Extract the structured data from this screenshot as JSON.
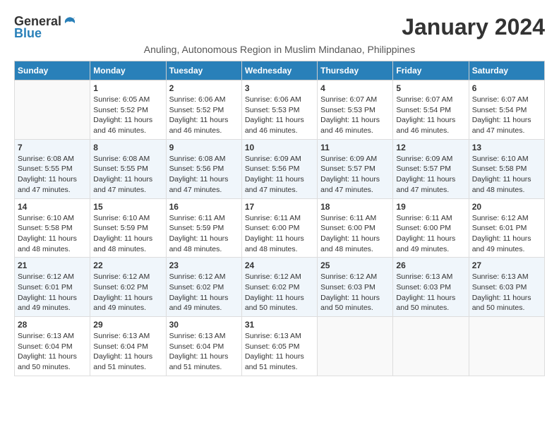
{
  "header": {
    "logo_general": "General",
    "logo_blue": "Blue",
    "month_title": "January 2024",
    "subtitle": "Anuling, Autonomous Region in Muslim Mindanao, Philippines"
  },
  "weekdays": [
    "Sunday",
    "Monday",
    "Tuesday",
    "Wednesday",
    "Thursday",
    "Friday",
    "Saturday"
  ],
  "weeks": [
    [
      {
        "day": null,
        "sunrise": null,
        "sunset": null,
        "daylight": null
      },
      {
        "day": "1",
        "sunrise": "Sunrise: 6:05 AM",
        "sunset": "Sunset: 5:52 PM",
        "daylight": "Daylight: 11 hours and 46 minutes."
      },
      {
        "day": "2",
        "sunrise": "Sunrise: 6:06 AM",
        "sunset": "Sunset: 5:52 PM",
        "daylight": "Daylight: 11 hours and 46 minutes."
      },
      {
        "day": "3",
        "sunrise": "Sunrise: 6:06 AM",
        "sunset": "Sunset: 5:53 PM",
        "daylight": "Daylight: 11 hours and 46 minutes."
      },
      {
        "day": "4",
        "sunrise": "Sunrise: 6:07 AM",
        "sunset": "Sunset: 5:53 PM",
        "daylight": "Daylight: 11 hours and 46 minutes."
      },
      {
        "day": "5",
        "sunrise": "Sunrise: 6:07 AM",
        "sunset": "Sunset: 5:54 PM",
        "daylight": "Daylight: 11 hours and 46 minutes."
      },
      {
        "day": "6",
        "sunrise": "Sunrise: 6:07 AM",
        "sunset": "Sunset: 5:54 PM",
        "daylight": "Daylight: 11 hours and 47 minutes."
      }
    ],
    [
      {
        "day": "7",
        "sunrise": "Sunrise: 6:08 AM",
        "sunset": "Sunset: 5:55 PM",
        "daylight": "Daylight: 11 hours and 47 minutes."
      },
      {
        "day": "8",
        "sunrise": "Sunrise: 6:08 AM",
        "sunset": "Sunset: 5:55 PM",
        "daylight": "Daylight: 11 hours and 47 minutes."
      },
      {
        "day": "9",
        "sunrise": "Sunrise: 6:08 AM",
        "sunset": "Sunset: 5:56 PM",
        "daylight": "Daylight: 11 hours and 47 minutes."
      },
      {
        "day": "10",
        "sunrise": "Sunrise: 6:09 AM",
        "sunset": "Sunset: 5:56 PM",
        "daylight": "Daylight: 11 hours and 47 minutes."
      },
      {
        "day": "11",
        "sunrise": "Sunrise: 6:09 AM",
        "sunset": "Sunset: 5:57 PM",
        "daylight": "Daylight: 11 hours and 47 minutes."
      },
      {
        "day": "12",
        "sunrise": "Sunrise: 6:09 AM",
        "sunset": "Sunset: 5:57 PM",
        "daylight": "Daylight: 11 hours and 47 minutes."
      },
      {
        "day": "13",
        "sunrise": "Sunrise: 6:10 AM",
        "sunset": "Sunset: 5:58 PM",
        "daylight": "Daylight: 11 hours and 48 minutes."
      }
    ],
    [
      {
        "day": "14",
        "sunrise": "Sunrise: 6:10 AM",
        "sunset": "Sunset: 5:58 PM",
        "daylight": "Daylight: 11 hours and 48 minutes."
      },
      {
        "day": "15",
        "sunrise": "Sunrise: 6:10 AM",
        "sunset": "Sunset: 5:59 PM",
        "daylight": "Daylight: 11 hours and 48 minutes."
      },
      {
        "day": "16",
        "sunrise": "Sunrise: 6:11 AM",
        "sunset": "Sunset: 5:59 PM",
        "daylight": "Daylight: 11 hours and 48 minutes."
      },
      {
        "day": "17",
        "sunrise": "Sunrise: 6:11 AM",
        "sunset": "Sunset: 6:00 PM",
        "daylight": "Daylight: 11 hours and 48 minutes."
      },
      {
        "day": "18",
        "sunrise": "Sunrise: 6:11 AM",
        "sunset": "Sunset: 6:00 PM",
        "daylight": "Daylight: 11 hours and 48 minutes."
      },
      {
        "day": "19",
        "sunrise": "Sunrise: 6:11 AM",
        "sunset": "Sunset: 6:00 PM",
        "daylight": "Daylight: 11 hours and 49 minutes."
      },
      {
        "day": "20",
        "sunrise": "Sunrise: 6:12 AM",
        "sunset": "Sunset: 6:01 PM",
        "daylight": "Daylight: 11 hours and 49 minutes."
      }
    ],
    [
      {
        "day": "21",
        "sunrise": "Sunrise: 6:12 AM",
        "sunset": "Sunset: 6:01 PM",
        "daylight": "Daylight: 11 hours and 49 minutes."
      },
      {
        "day": "22",
        "sunrise": "Sunrise: 6:12 AM",
        "sunset": "Sunset: 6:02 PM",
        "daylight": "Daylight: 11 hours and 49 minutes."
      },
      {
        "day": "23",
        "sunrise": "Sunrise: 6:12 AM",
        "sunset": "Sunset: 6:02 PM",
        "daylight": "Daylight: 11 hours and 49 minutes."
      },
      {
        "day": "24",
        "sunrise": "Sunrise: 6:12 AM",
        "sunset": "Sunset: 6:02 PM",
        "daylight": "Daylight: 11 hours and 50 minutes."
      },
      {
        "day": "25",
        "sunrise": "Sunrise: 6:12 AM",
        "sunset": "Sunset: 6:03 PM",
        "daylight": "Daylight: 11 hours and 50 minutes."
      },
      {
        "day": "26",
        "sunrise": "Sunrise: 6:13 AM",
        "sunset": "Sunset: 6:03 PM",
        "daylight": "Daylight: 11 hours and 50 minutes."
      },
      {
        "day": "27",
        "sunrise": "Sunrise: 6:13 AM",
        "sunset": "Sunset: 6:03 PM",
        "daylight": "Daylight: 11 hours and 50 minutes."
      }
    ],
    [
      {
        "day": "28",
        "sunrise": "Sunrise: 6:13 AM",
        "sunset": "Sunset: 6:04 PM",
        "daylight": "Daylight: 11 hours and 50 minutes."
      },
      {
        "day": "29",
        "sunrise": "Sunrise: 6:13 AM",
        "sunset": "Sunset: 6:04 PM",
        "daylight": "Daylight: 11 hours and 51 minutes."
      },
      {
        "day": "30",
        "sunrise": "Sunrise: 6:13 AM",
        "sunset": "Sunset: 6:04 PM",
        "daylight": "Daylight: 11 hours and 51 minutes."
      },
      {
        "day": "31",
        "sunrise": "Sunrise: 6:13 AM",
        "sunset": "Sunset: 6:05 PM",
        "daylight": "Daylight: 11 hours and 51 minutes."
      },
      {
        "day": null,
        "sunrise": null,
        "sunset": null,
        "daylight": null
      },
      {
        "day": null,
        "sunrise": null,
        "sunset": null,
        "daylight": null
      },
      {
        "day": null,
        "sunrise": null,
        "sunset": null,
        "daylight": null
      }
    ]
  ]
}
